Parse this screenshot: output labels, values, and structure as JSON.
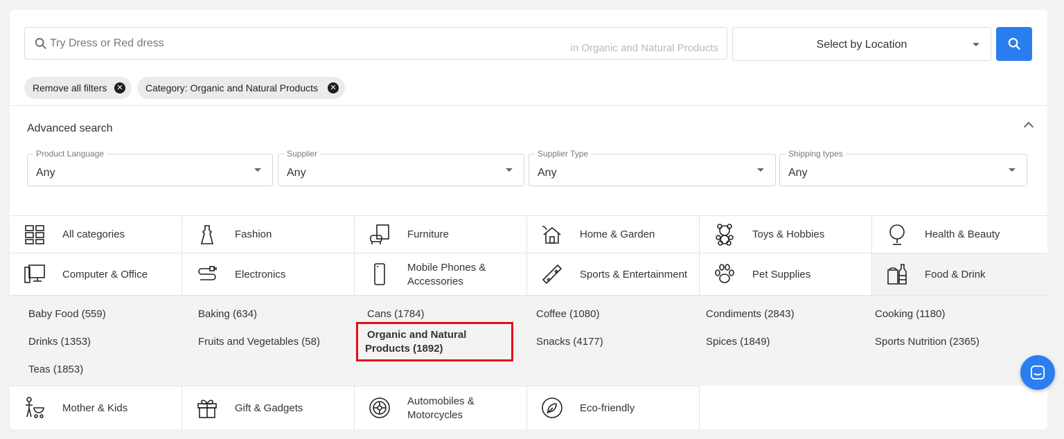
{
  "search": {
    "placeholder": "Try Dress or Red dress",
    "scope_label": "in Organic and Natural Products",
    "location_label": "Select by Location"
  },
  "filters": {
    "remove_all": "Remove all filters",
    "category_chip": "Category: Organic and Natural Products"
  },
  "advanced": {
    "title": "Advanced search",
    "fields": [
      {
        "legend": "Product Language",
        "value": "Any"
      },
      {
        "legend": "Supplier",
        "value": "Any"
      },
      {
        "legend": "Supplier Type",
        "value": "Any"
      },
      {
        "legend": "Shipping types",
        "value": "Any"
      }
    ]
  },
  "categories": {
    "row1": [
      {
        "label": "All categories",
        "icon": "grid-icon"
      },
      {
        "label": "Fashion",
        "icon": "dress-icon"
      },
      {
        "label": "Furniture",
        "icon": "armchair-icon"
      },
      {
        "label": "Home & Garden",
        "icon": "house-icon"
      },
      {
        "label": "Toys & Hobbies",
        "icon": "teddy-bear-icon"
      },
      {
        "label": "Health & Beauty",
        "icon": "mirror-icon"
      }
    ],
    "row2": [
      {
        "label": "Computer & Office",
        "icon": "computer-icon"
      },
      {
        "label": "Electronics",
        "icon": "cable-plug-icon"
      },
      {
        "label": "Mobile Phones & Accessories",
        "icon": "phone-icon"
      },
      {
        "label": "Sports & Entertainment",
        "icon": "skateboard-icon"
      },
      {
        "label": "Pet Supplies",
        "icon": "paw-icon"
      },
      {
        "label": "Food & Drink",
        "icon": "food-drink-icon"
      }
    ],
    "row3": [
      {
        "label": "Mother & Kids",
        "icon": "mother-stroller-icon"
      },
      {
        "label": "Gift & Gadgets",
        "icon": "gift-icon"
      },
      {
        "label": "Automobiles & Motorcycles",
        "icon": "wheel-icon"
      },
      {
        "label": "Eco-friendly",
        "icon": "leaf-icon"
      }
    ]
  },
  "subcategories": [
    "Baby Food (559)",
    "Baking (634)",
    "Cans (1784)",
    "Coffee (1080)",
    "Condiments (2843)",
    "Cooking (1180)",
    "Drinks (1353)",
    "Fruits and Vegetables (58)",
    "Organic and Natural Products (1892)",
    "Snacks (4177)",
    "Spices (1849)",
    "Sports Nutrition (2365)",
    "Teas (1853)"
  ],
  "colors": {
    "accent": "#2a7ef0",
    "highlight_border": "#e0101a",
    "active_bg": "#f3f3f3"
  }
}
